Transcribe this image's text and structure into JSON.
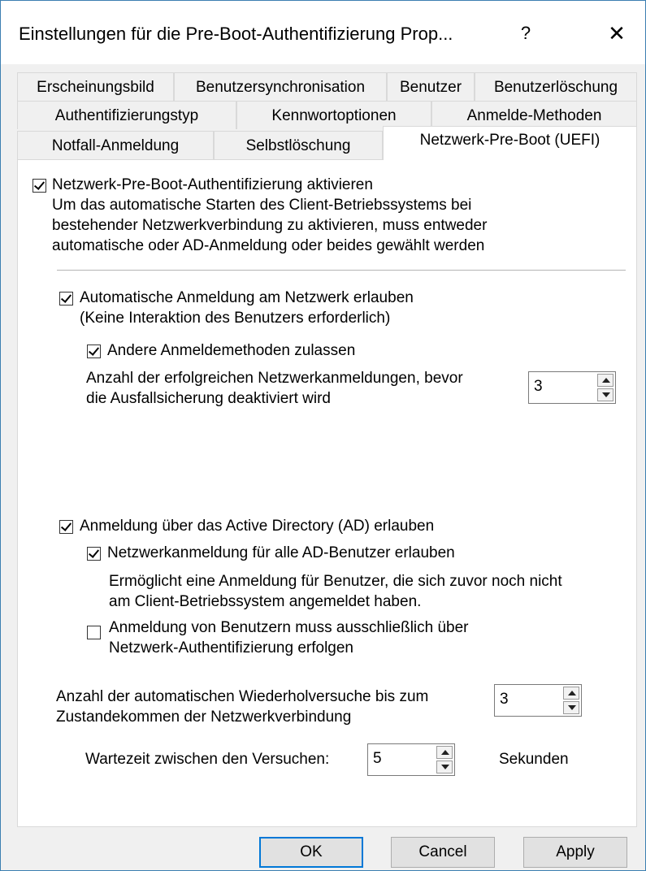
{
  "window": {
    "title": "Einstellungen für die Pre-Boot-Authentifizierung Prop...",
    "help": "?",
    "close": "✕"
  },
  "tabs": {
    "row1": [
      "Erscheinungsbild",
      "Benutzersynchronisation",
      "Benutzer",
      "Benutzerlöschung"
    ],
    "row2": [
      "Authentifizierungstyp",
      "Kennwortoptionen",
      "Anmelde-Methoden"
    ],
    "row3": [
      "Notfall-Anmeldung",
      "Selbstlöschung",
      "Netzwerk-Pre-Boot (UEFI)"
    ]
  },
  "panel": {
    "enable_label": "Netzwerk-Pre-Boot-Authentifizierung aktivieren",
    "enable_desc": [
      "Um das automatische Starten des Client-Betriebssystems bei",
      "bestehender Netzwerkverbindung zu aktivieren, muss entweder",
      "automatische oder AD-Anmeldung oder beides gewählt werden"
    ],
    "auto_login_label": "Automatische Anmeldung am Netzwerk erlauben",
    "auto_login_desc": "(Keine Interaktion des Benutzers erforderlich)",
    "other_methods_label": "Andere Anmeldemethoden zulassen",
    "failsafe_label": [
      "Anzahl der erfolgreichen Netzwerkanmeldungen, bevor",
      "die Ausfallsicherung deaktiviert wird"
    ],
    "failsafe_value": "3",
    "ad_login_label": "Anmeldung über das Active Directory (AD) erlauben",
    "all_ad_users_label": "Netzwerkanmeldung für alle AD-Benutzer erlauben",
    "all_ad_users_desc": [
      "Ermöglicht eine Anmeldung für Benutzer, die sich zuvor noch nicht",
      "am Client-Betriebssystem angemeldet haben."
    ],
    "exclusive_label": [
      "Anmeldung von Benutzern muss ausschließlich über",
      "Netzwerk-Authentifizierung erfolgen"
    ],
    "retries_label": [
      "Anzahl der automatischen Wiederholversuche bis zum",
      "Zustandekommen der Netzwerkverbindung"
    ],
    "retries_value": "3",
    "wait_label": "Wartezeit zwischen den Versuchen:",
    "wait_value": "5",
    "wait_unit": "Sekunden"
  },
  "buttons": {
    "ok": "OK",
    "cancel": "Cancel",
    "apply": "Apply"
  },
  "colors": {
    "accent": "#0078d7",
    "window_border": "#3c7fb1"
  }
}
